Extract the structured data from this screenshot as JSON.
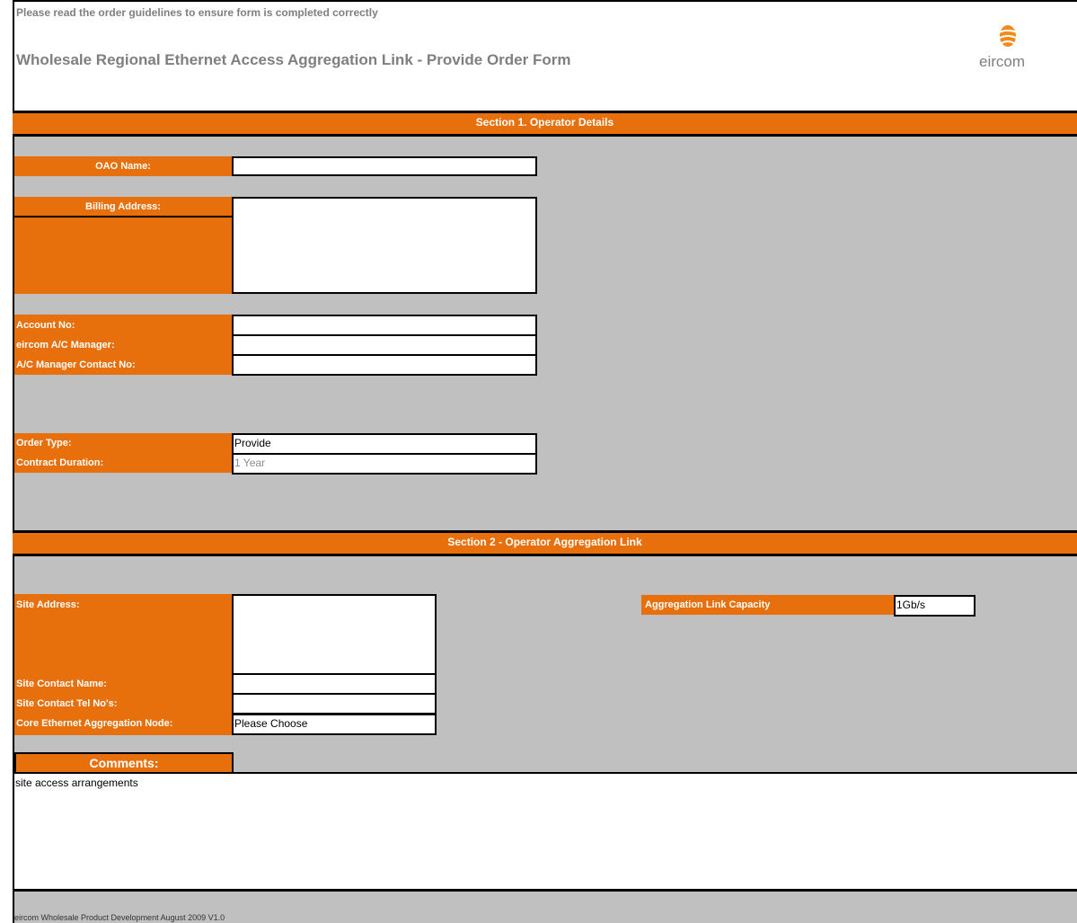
{
  "header": {
    "guideline_note": "Please read the order guidelines to ensure form is completed correctly",
    "form_title": "Wholesale Regional Ethernet Access Aggregation Link - Provide  Order Form",
    "logo_text": "eircom"
  },
  "section1": {
    "title": "Section 1. Operator Details",
    "oao_name_label": "OAO Name:",
    "oao_name_value": "",
    "billing_address_label": "Billing Address:",
    "billing_address_value": "",
    "account_no_label": "Account No:",
    "account_no_value": "",
    "ac_manager_label": "eircom A/C Manager:",
    "ac_manager_value": "",
    "ac_manager_contact_label": "A/C Manager Contact No:",
    "ac_manager_contact_value": "",
    "order_type_label": "Order Type:",
    "order_type_value": "Provide",
    "contract_duration_label": "Contract Duration:",
    "contract_duration_value": "1 Year"
  },
  "section2": {
    "title": "Section 2  - Operator Aggregation Link",
    "site_address_label": "Site Address:",
    "site_address_value": "",
    "site_contact_name_label": "Site Contact Name:",
    "site_contact_name_value": "",
    "site_contact_tel_label": "Site Contact Tel No's:",
    "site_contact_tel_value": "",
    "core_node_label": "Core Ethernet Aggregation Node:",
    "core_node_value": "Please Choose",
    "capacity_label": "Aggregation Link Capacity",
    "capacity_value": "1Gb/s",
    "comments_label": "Comments:",
    "comments_value": "site access arrangements"
  },
  "footer": {
    "text": "eircom Wholesale Product Development August 2009 V1.0"
  },
  "colors": {
    "accent_orange": "#e8700c",
    "panel_grey": "#c0c0c0",
    "header_text_grey": "#7f7f7f"
  }
}
